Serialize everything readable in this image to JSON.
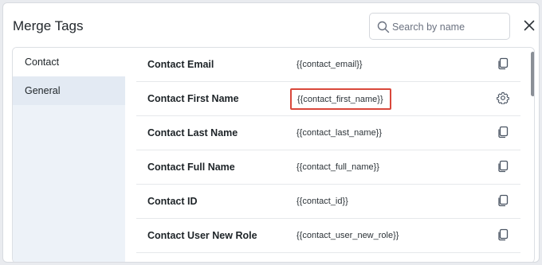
{
  "dialog": {
    "title": "Merge Tags",
    "search": {
      "placeholder": "Search by name",
      "value": ""
    }
  },
  "sidebar": {
    "items": [
      {
        "label": "Contact"
      },
      {
        "label": "General"
      }
    ]
  },
  "tags": [
    {
      "name": "Contact Email",
      "tag": "{{contact_email}}",
      "icon": "copy-icon"
    },
    {
      "name": "Contact First Name",
      "tag": "{{contact_first_name}}",
      "icon": "gear-icon"
    },
    {
      "name": "Contact Last Name",
      "tag": "{{contact_last_name}}",
      "icon": "copy-icon"
    },
    {
      "name": "Contact Full Name",
      "tag": "{{contact_full_name}}",
      "icon": "copy-icon"
    },
    {
      "name": "Contact ID",
      "tag": "{{contact_id}}",
      "icon": "copy-icon"
    },
    {
      "name": "Contact User New Role",
      "tag": "{{contact_user_new_role}}",
      "icon": "copy-icon"
    }
  ],
  "colors": {
    "highlight": "#d9473b",
    "sidebar_bg": "#edf2f8"
  }
}
